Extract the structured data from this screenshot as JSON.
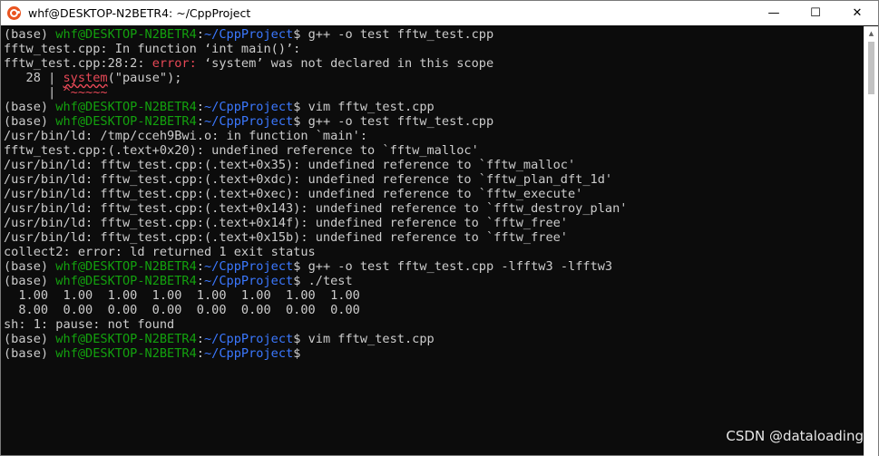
{
  "window": {
    "title": "whf@DESKTOP-N2BETR4: ~/CppProject",
    "controls": {
      "minimize": "—",
      "maximize": "☐",
      "close": "✕"
    }
  },
  "terminal": {
    "lines": [
      [
        {
          "t": "(base) ",
          "c": "w"
        },
        {
          "t": "whf@DESKTOP-N2BETR4",
          "c": "g"
        },
        {
          "t": ":",
          "c": "w"
        },
        {
          "t": "~/CppProject",
          "c": "b"
        },
        {
          "t": "$ g++ -o test fftw_test.cpp",
          "c": "w"
        }
      ],
      [
        {
          "t": "fftw_test.cpp: In function ‘int main()’:",
          "c": "w"
        }
      ],
      [
        {
          "t": "fftw_test.cpp:28:2: ",
          "c": "w"
        },
        {
          "t": "error: ",
          "c": "r"
        },
        {
          "t": "‘system’ was not declared in this scope",
          "c": "w"
        }
      ],
      [
        {
          "t": "   28 | ",
          "c": "w"
        },
        {
          "t": "system",
          "c": "r",
          "s": true
        },
        {
          "t": "(\"pause\");",
          "c": "w"
        }
      ],
      [
        {
          "t": "      | ",
          "c": "w"
        },
        {
          "t": "^~~~~~",
          "c": "r"
        }
      ],
      [
        {
          "t": "(base) ",
          "c": "w"
        },
        {
          "t": "whf@DESKTOP-N2BETR4",
          "c": "g"
        },
        {
          "t": ":",
          "c": "w"
        },
        {
          "t": "~/CppProject",
          "c": "b"
        },
        {
          "t": "$ vim fftw_test.cpp",
          "c": "w"
        }
      ],
      [
        {
          "t": "(base) ",
          "c": "w"
        },
        {
          "t": "whf@DESKTOP-N2BETR4",
          "c": "g"
        },
        {
          "t": ":",
          "c": "w"
        },
        {
          "t": "~/CppProject",
          "c": "b"
        },
        {
          "t": "$ g++ -o test fftw_test.cpp",
          "c": "w"
        }
      ],
      [
        {
          "t": "/usr/bin/ld: /tmp/cceh9Bwi.o: in function `main':",
          "c": "w"
        }
      ],
      [
        {
          "t": "fftw_test.cpp:(.text+0x20): undefined reference to `fftw_malloc'",
          "c": "w"
        }
      ],
      [
        {
          "t": "/usr/bin/ld: fftw_test.cpp:(.text+0x35): undefined reference to `fftw_malloc'",
          "c": "w"
        }
      ],
      [
        {
          "t": "/usr/bin/ld: fftw_test.cpp:(.text+0xdc): undefined reference to `fftw_plan_dft_1d'",
          "c": "w"
        }
      ],
      [
        {
          "t": "/usr/bin/ld: fftw_test.cpp:(.text+0xec): undefined reference to `fftw_execute'",
          "c": "w"
        }
      ],
      [
        {
          "t": "/usr/bin/ld: fftw_test.cpp:(.text+0x143): undefined reference to `fftw_destroy_plan'",
          "c": "w"
        }
      ],
      [
        {
          "t": "/usr/bin/ld: fftw_test.cpp:(.text+0x14f): undefined reference to `fftw_free'",
          "c": "w"
        }
      ],
      [
        {
          "t": "/usr/bin/ld: fftw_test.cpp:(.text+0x15b): undefined reference to `fftw_free'",
          "c": "w"
        }
      ],
      [
        {
          "t": "collect2: error: ld returned 1 exit status",
          "c": "w"
        }
      ],
      [
        {
          "t": "(base) ",
          "c": "w"
        },
        {
          "t": "whf@DESKTOP-N2BETR4",
          "c": "g"
        },
        {
          "t": ":",
          "c": "w"
        },
        {
          "t": "~/CppProject",
          "c": "b"
        },
        {
          "t": "$ g++ -o test fftw_test.cpp -lfftw3 -lfftw3",
          "c": "w"
        }
      ],
      [
        {
          "t": "(base) ",
          "c": "w"
        },
        {
          "t": "whf@DESKTOP-N2BETR4",
          "c": "g"
        },
        {
          "t": ":",
          "c": "w"
        },
        {
          "t": "~/CppProject",
          "c": "b"
        },
        {
          "t": "$ ./test",
          "c": "w"
        }
      ],
      [
        {
          "t": "  1.00  1.00  1.00  1.00  1.00  1.00  1.00  1.00",
          "c": "w"
        }
      ],
      [
        {
          "t": "  8.00  0.00  0.00  0.00  0.00  0.00  0.00  0.00",
          "c": "w"
        }
      ],
      [
        {
          "t": "sh: 1: pause: not found",
          "c": "w"
        }
      ],
      [
        {
          "t": "(base) ",
          "c": "w"
        },
        {
          "t": "whf@DESKTOP-N2BETR4",
          "c": "g"
        },
        {
          "t": ":",
          "c": "w"
        },
        {
          "t": "~/CppProject",
          "c": "b"
        },
        {
          "t": "$ vim fftw_test.cpp",
          "c": "w"
        }
      ],
      [
        {
          "t": "(base) ",
          "c": "w"
        },
        {
          "t": "whf@DESKTOP-N2BETR4",
          "c": "g"
        },
        {
          "t": ":",
          "c": "w"
        },
        {
          "t": "~/CppProject",
          "c": "b"
        },
        {
          "t": "$",
          "c": "w"
        }
      ]
    ]
  },
  "watermark": "CSDN @dataloading",
  "colors": {
    "background": "#0c0c0c",
    "text": "#cccccc",
    "user_host": "#13a10e",
    "path": "#3b78ff",
    "error": "#e74856"
  }
}
